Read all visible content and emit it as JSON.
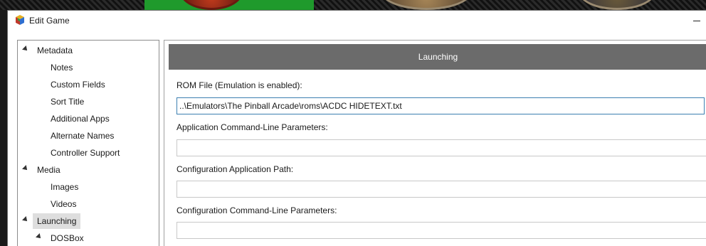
{
  "window": {
    "title": "Edit Game",
    "icon": "launchbox-cube-icon"
  },
  "tree": {
    "items": [
      {
        "label": "Metadata",
        "expanded": true
      },
      {
        "label": "Notes"
      },
      {
        "label": "Custom Fields"
      },
      {
        "label": "Sort Title"
      },
      {
        "label": "Additional Apps"
      },
      {
        "label": "Alternate Names"
      },
      {
        "label": "Controller Support"
      },
      {
        "label": "Media",
        "expanded": true
      },
      {
        "label": "Images"
      },
      {
        "label": "Videos"
      },
      {
        "label": "Launching",
        "expanded": true,
        "selected": true
      },
      {
        "label": "DOSBox",
        "expanded": true
      }
    ]
  },
  "panel": {
    "header": "Launching",
    "rom_file": {
      "label": "ROM File (Emulation is enabled):",
      "value": "..\\Emulators\\The Pinball Arcade\\roms\\ACDC HIDETEXT.txt"
    },
    "app_cmd_params": {
      "label": "Application Command-Line Parameters:",
      "value": ""
    },
    "config_app_path": {
      "label": "Configuration Application Path:",
      "value": ""
    },
    "config_cmd_params": {
      "label": "Configuration Command-Line Parameters:",
      "value": ""
    }
  },
  "colors": {
    "header_bg": "#6b6b6b",
    "selected_bg": "#dedede",
    "focus_border": "#3c7fb1"
  }
}
